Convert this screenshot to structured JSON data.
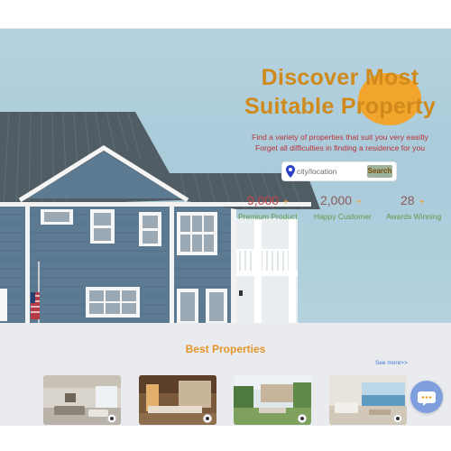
{
  "hero": {
    "title_line1": "Discover Most",
    "title_line2": "Suitable Property",
    "subtitle_line1": "Find a variety of properties that suit you very easilty",
    "subtitle_line2": "Forget all difficulties in finding a residence for you",
    "search": {
      "placeholder": "city/location",
      "button_label": "Search"
    },
    "stats": [
      {
        "value": "9,000",
        "label": "Premium Product"
      },
      {
        "value": "2,000",
        "label": "Happy Customer"
      },
      {
        "value": "28",
        "label": "Awards Winning"
      }
    ],
    "stat_plus": "+"
  },
  "properties": {
    "title": "Best Properties",
    "see_more": "See more>>",
    "cards": [
      {
        "name": "living-room-photo"
      },
      {
        "name": "kitchen-photo"
      },
      {
        "name": "courtyard-photo"
      },
      {
        "name": "oceanview-room-photo"
      }
    ]
  },
  "colors": {
    "title": "#cf8a1b",
    "subtitle": "#b8323a",
    "search_button": "#9db29a",
    "section_title": "#e3952c",
    "link": "#3a78d6",
    "chat_button": "#7f9ede"
  },
  "icons": {
    "location": "map-pin-icon",
    "chat": "chat-bubble-icon"
  }
}
